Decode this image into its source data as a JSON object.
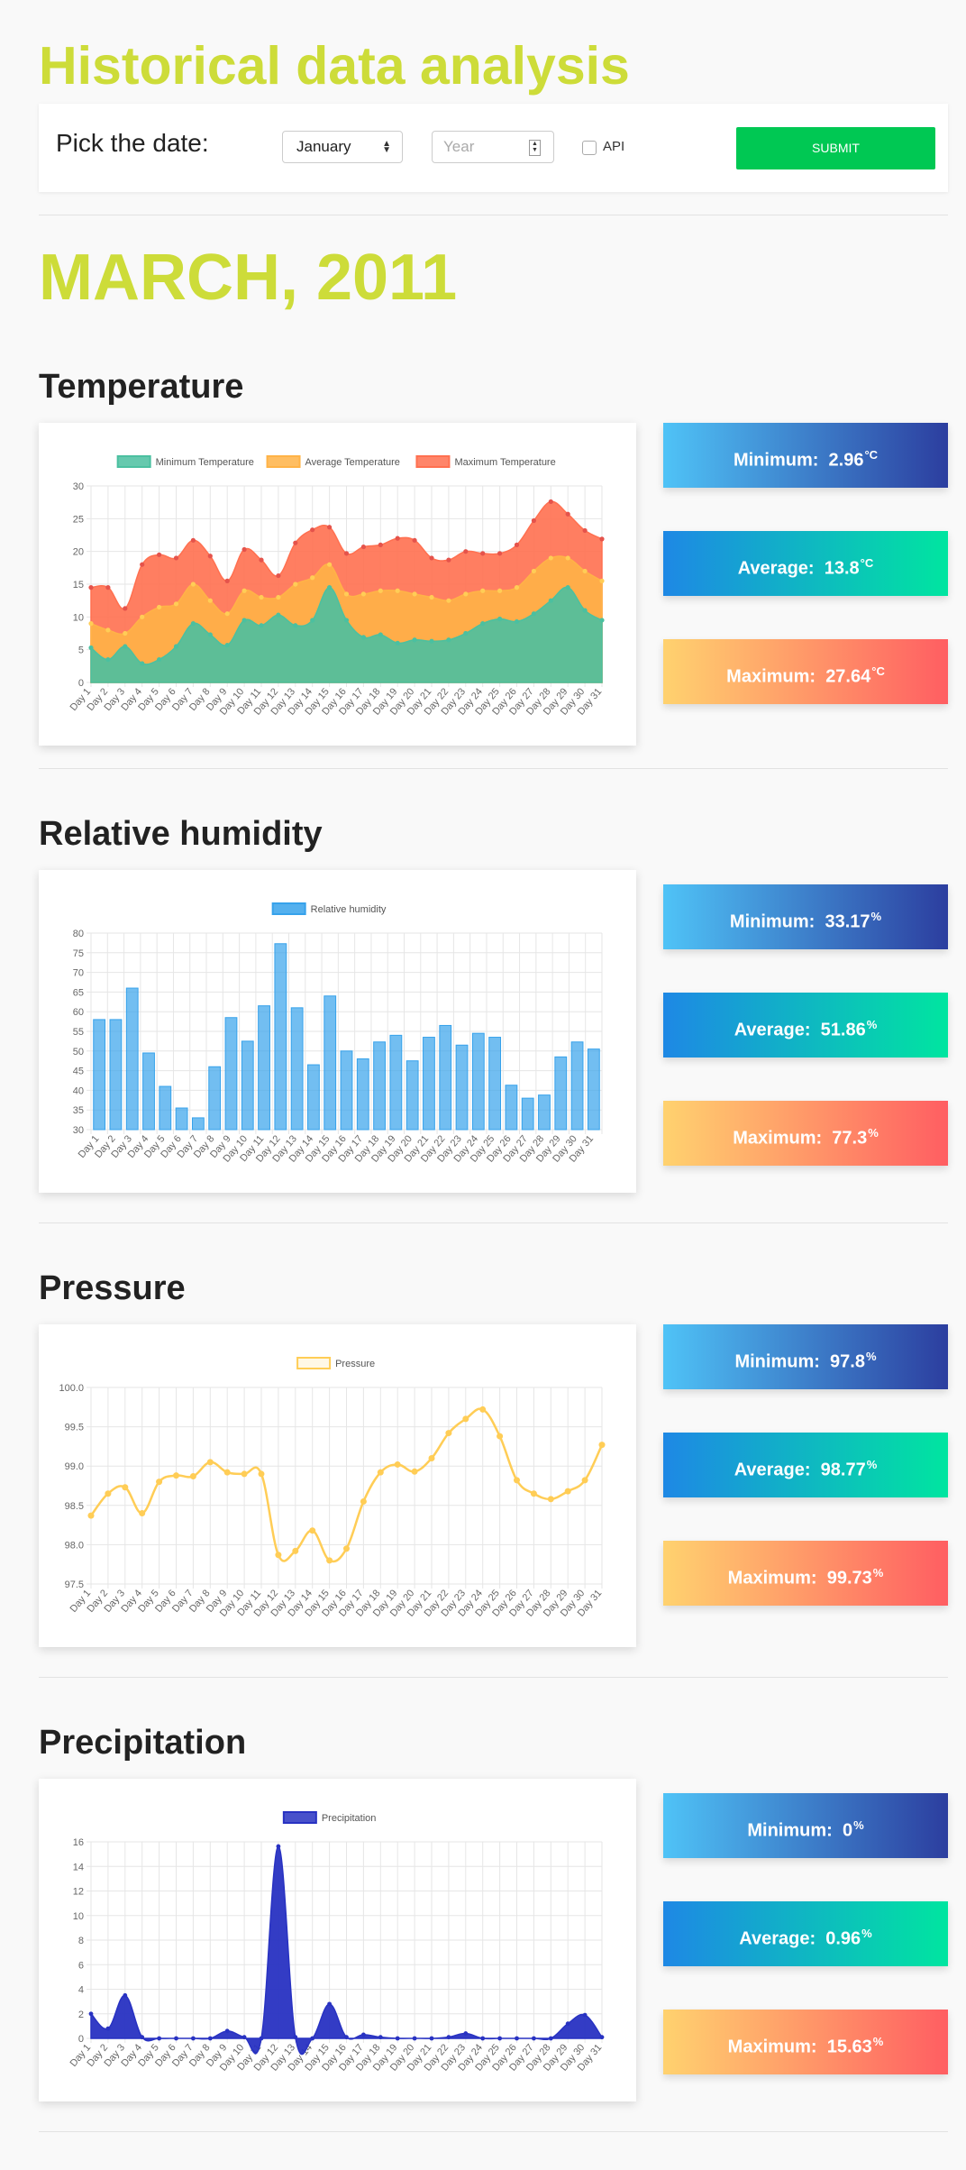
{
  "header": {
    "title": "Historical data analysis"
  },
  "form": {
    "label": "Pick the date:",
    "month_value": "January",
    "year_placeholder": "Year",
    "api_label": "API",
    "submit_label": "SUBMIT"
  },
  "month_title": "MARCH, 2011",
  "sections": [
    {
      "key": "temperature",
      "title": "Temperature",
      "stats": {
        "min_label": "Minimum:",
        "min_value": "2.96",
        "avg_label": "Average:",
        "avg_value": "13.8",
        "max_label": "Maximum:",
        "max_value": "27.64",
        "unit": "°C"
      }
    },
    {
      "key": "humidity",
      "title": "Relative humidity",
      "stats": {
        "min_label": "Minimum:",
        "min_value": "33.17",
        "avg_label": "Average:",
        "avg_value": "51.86",
        "max_label": "Maximum:",
        "max_value": "77.3",
        "unit": "%"
      }
    },
    {
      "key": "pressure",
      "title": "Pressure",
      "stats": {
        "min_label": "Minimum:",
        "min_value": "97.8",
        "avg_label": "Average:",
        "avg_value": "98.77",
        "max_label": "Maximum:",
        "max_value": "99.73",
        "unit": "%"
      }
    },
    {
      "key": "precipitation",
      "title": "Precipitation",
      "stats": {
        "min_label": "Minimum:",
        "min_value": "0",
        "avg_label": "Average:",
        "avg_value": "0.96",
        "max_label": "Maximum:",
        "max_value": "15.63",
        "unit": "%"
      }
    }
  ],
  "chart_data": [
    {
      "type": "area",
      "title": "",
      "xlabel": "",
      "ylabel": "",
      "categories": [
        "Day 1",
        "Day 2",
        "Day 3",
        "Day 4",
        "Day 5",
        "Day 6",
        "Day 7",
        "Day 8",
        "Day 9",
        "Day 10",
        "Day 11",
        "Day 12",
        "Day 13",
        "Day 14",
        "Day 15",
        "Day 16",
        "Day 17",
        "Day 18",
        "Day 19",
        "Day 20",
        "Day 21",
        "Day 22",
        "Day 23",
        "Day 24",
        "Day 25",
        "Day 26",
        "Day 27",
        "Day 28",
        "Day 29",
        "Day 30",
        "Day 31"
      ],
      "ylim": [
        0,
        30
      ],
      "yticks": [
        0,
        5,
        10,
        15,
        20,
        25,
        30
      ],
      "legend": "top",
      "grid": true,
      "series": [
        {
          "name": "Minimum Temperature",
          "color": "#4bc0c0",
          "values": [
            5.3,
            3.5,
            5.5,
            2.9,
            3.5,
            5.5,
            9.0,
            7.3,
            5.7,
            9.5,
            8.7,
            10.3,
            8.7,
            9.5,
            14.5,
            9.5,
            6.9,
            7.3,
            6.0,
            6.5,
            6.3,
            6.5,
            7.5,
            9.0,
            9.7,
            9.3,
            10.5,
            12.5,
            14.5,
            11.0,
            9.5
          ]
        },
        {
          "name": "Average Temperature",
          "color": "#ffcd56",
          "values": [
            9.0,
            8.0,
            7.5,
            10.0,
            11.5,
            12.0,
            15.0,
            12.5,
            10.5,
            14.0,
            13.0,
            13.0,
            15.0,
            16.0,
            18.0,
            13.5,
            13.5,
            14.0,
            14.0,
            13.5,
            13.0,
            12.5,
            13.5,
            14.0,
            14.0,
            14.5,
            17.0,
            19.0,
            19.0,
            17.0,
            15.5
          ]
        },
        {
          "name": "Maximum Temperature",
          "color": "#ff6384",
          "values": [
            14.5,
            14.5,
            11.3,
            18.0,
            19.5,
            19.0,
            21.7,
            19.3,
            15.5,
            20.3,
            18.7,
            16.3,
            21.3,
            23.3,
            23.7,
            19.7,
            20.7,
            21.0,
            22.0,
            21.7,
            19.0,
            18.7,
            20.0,
            19.7,
            19.7,
            21.0,
            24.7,
            27.6,
            25.7,
            23.2,
            21.9
          ]
        }
      ]
    },
    {
      "type": "bar",
      "title": "",
      "xlabel": "",
      "ylabel": "",
      "categories": [
        "Day 1",
        "Day 2",
        "Day 3",
        "Day 4",
        "Day 5",
        "Day 6",
        "Day 7",
        "Day 8",
        "Day 9",
        "Day 10",
        "Day 11",
        "Day 12",
        "Day 13",
        "Day 14",
        "Day 15",
        "Day 16",
        "Day 17",
        "Day 18",
        "Day 19",
        "Day 20",
        "Day 21",
        "Day 22",
        "Day 23",
        "Day 24",
        "Day 25",
        "Day 26",
        "Day 27",
        "Day 28",
        "Day 29",
        "Day 30",
        "Day 31"
      ],
      "ylim": [
        30,
        80
      ],
      "yticks": [
        30,
        35,
        40,
        45,
        50,
        55,
        60,
        65,
        70,
        75,
        80
      ],
      "legend": "top",
      "grid": true,
      "series": [
        {
          "name": "Relative humidity",
          "color": "#36a2eb",
          "values": [
            58,
            58,
            66,
            49.5,
            41,
            35.5,
            33,
            46,
            58.5,
            52.5,
            61.5,
            77.3,
            61,
            46.5,
            64,
            50,
            48,
            52.3,
            54,
            47.5,
            53.5,
            56.5,
            51.5,
            54.5,
            53.5,
            41.3,
            38,
            38.8,
            48.5,
            52.3,
            50.5
          ]
        }
      ]
    },
    {
      "type": "line",
      "title": "",
      "xlabel": "",
      "ylabel": "",
      "categories": [
        "Day 1",
        "Day 2",
        "Day 3",
        "Day 4",
        "Day 5",
        "Day 6",
        "Day 7",
        "Day 8",
        "Day 9",
        "Day 10",
        "Day 11",
        "Day 12",
        "Day 13",
        "Day 14",
        "Day 15",
        "Day 16",
        "Day 17",
        "Day 18",
        "Day 19",
        "Day 20",
        "Day 21",
        "Day 22",
        "Day 23",
        "Day 24",
        "Day 25",
        "Day 26",
        "Day 27",
        "Day 28",
        "Day 29",
        "Day 30",
        "Day 31"
      ],
      "ylim": [
        97.5,
        100.0
      ],
      "yticks": [
        "97.5",
        "98.0",
        "98.5",
        "99.0",
        "99.5",
        "100.0"
      ],
      "legend": "top",
      "grid": true,
      "series": [
        {
          "name": "Pressure",
          "color": "#ffcd56",
          "values": [
            98.37,
            98.65,
            98.73,
            98.4,
            98.8,
            98.88,
            98.87,
            99.05,
            98.92,
            98.9,
            98.9,
            97.87,
            97.92,
            98.18,
            97.8,
            97.95,
            98.55,
            98.92,
            99.02,
            98.93,
            99.1,
            99.42,
            99.6,
            99.72,
            99.38,
            98.82,
            98.65,
            98.58,
            98.68,
            98.82,
            99.27
          ]
        }
      ]
    },
    {
      "type": "area",
      "title": "",
      "xlabel": "",
      "ylabel": "",
      "categories": [
        "Day 1",
        "Day 2",
        "Day 3",
        "Day 4",
        "Day 5",
        "Day 6",
        "Day 7",
        "Day 8",
        "Day 9",
        "Day 10",
        "Day 11",
        "Day 12",
        "Day 13",
        "Day 14",
        "Day 15",
        "Day 16",
        "Day 17",
        "Day 18",
        "Day 19",
        "Day 20",
        "Day 21",
        "Day 22",
        "Day 23",
        "Day 24",
        "Day 25",
        "Day 26",
        "Day 27",
        "Day 28",
        "Day 29",
        "Day 30",
        "Day 31"
      ],
      "ylim": [
        0,
        16
      ],
      "yticks": [
        0,
        2,
        4,
        6,
        8,
        10,
        12,
        14,
        16
      ],
      "legend": "top",
      "grid": true,
      "series": [
        {
          "name": "Precipitation",
          "color": "#2832c2",
          "values": [
            2.0,
            0.8,
            3.5,
            0.1,
            0,
            0,
            0,
            0,
            0.6,
            0.1,
            0,
            15.63,
            0.1,
            0,
            2.8,
            0.1,
            0.3,
            0.1,
            0,
            0,
            0,
            0.1,
            0.4,
            0,
            0,
            0,
            0,
            0,
            1.2,
            1.9,
            0.1
          ]
        }
      ]
    }
  ]
}
